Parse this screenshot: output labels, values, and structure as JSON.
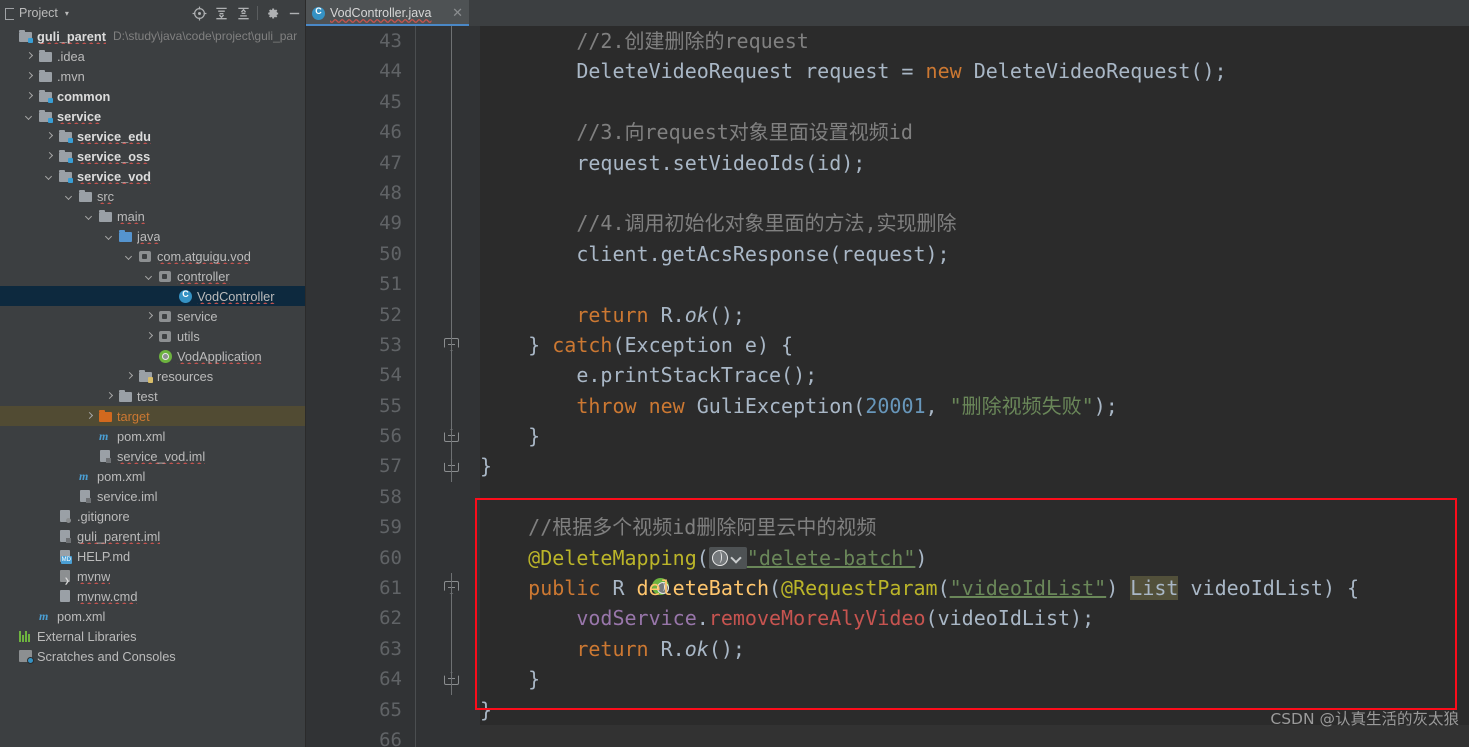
{
  "toolwindow": {
    "title": "Project",
    "dropdown_caret": "▾",
    "buttons": [
      {
        "name": "locate-in-tree",
        "label": "Select Opened File"
      },
      {
        "name": "expand-all",
        "label": "Expand All"
      },
      {
        "name": "collapse-all",
        "label": "Collapse All"
      },
      {
        "name": "settings",
        "label": "Settings"
      },
      {
        "name": "hide",
        "label": "Hide"
      }
    ]
  },
  "tree": [
    {
      "label": "guli_parent",
      "detail": "D:\\study\\java\\code\\project\\guli_par",
      "indent": 0,
      "icon": "module-folder-icon",
      "toggle": "none",
      "bold": true,
      "spell": true
    },
    {
      "label": ".idea",
      "indent": 1,
      "icon": "folder-icon",
      "toggle": "right"
    },
    {
      "label": ".mvn",
      "indent": 1,
      "icon": "folder-icon",
      "toggle": "right"
    },
    {
      "label": "common",
      "indent": 1,
      "icon": "module-folder-icon",
      "toggle": "right",
      "bold": true
    },
    {
      "label": "service",
      "indent": 1,
      "icon": "module-folder-icon",
      "toggle": "down",
      "bold": true,
      "spell": true
    },
    {
      "label": "service_edu",
      "indent": 2,
      "icon": "module-folder-icon",
      "toggle": "right",
      "bold": true,
      "spell": true
    },
    {
      "label": "service_oss",
      "indent": 2,
      "icon": "module-folder-icon",
      "toggle": "right",
      "bold": true,
      "spell": true
    },
    {
      "label": "service_vod",
      "indent": 2,
      "icon": "module-folder-icon",
      "toggle": "down",
      "bold": true,
      "spell": true
    },
    {
      "label": "src",
      "indent": 3,
      "icon": "folder-icon",
      "toggle": "down",
      "spell": true
    },
    {
      "label": "main",
      "indent": 4,
      "icon": "folder-icon",
      "toggle": "down",
      "spell": true
    },
    {
      "label": "java",
      "indent": 5,
      "icon": "source-folder-icon",
      "toggle": "down",
      "spell": true
    },
    {
      "label": "com.atguigu.vod",
      "indent": 6,
      "icon": "package-icon",
      "toggle": "down",
      "spell": true
    },
    {
      "label": "controller",
      "indent": 7,
      "icon": "package-icon",
      "toggle": "down",
      "spell": true
    },
    {
      "label": "VodController",
      "indent": 8,
      "icon": "class-icon",
      "toggle": "none",
      "selected": true,
      "spell": true
    },
    {
      "label": "service",
      "indent": 7,
      "icon": "package-icon",
      "toggle": "right"
    },
    {
      "label": "utils",
      "indent": 7,
      "icon": "package-icon",
      "toggle": "right"
    },
    {
      "label": "VodApplication",
      "indent": 7,
      "icon": "spring-boot-icon",
      "toggle": "none",
      "spell": true
    },
    {
      "label": "resources",
      "indent": 6,
      "icon": "resources-folder-icon",
      "toggle": "right"
    },
    {
      "label": "test",
      "indent": 5,
      "icon": "folder-icon",
      "toggle": "right"
    },
    {
      "label": "target",
      "indent": 4,
      "icon": "excluded-folder-icon",
      "toggle": "right",
      "excluded": true,
      "orange": true
    },
    {
      "label": "pom.xml",
      "indent": 4,
      "icon": "maven-icon",
      "toggle": "none"
    },
    {
      "label": "service_vod.iml",
      "indent": 4,
      "icon": "iml-file-icon",
      "toggle": "none",
      "spell": true
    },
    {
      "label": "pom.xml",
      "indent": 3,
      "icon": "maven-icon",
      "toggle": "none"
    },
    {
      "label": "service.iml",
      "indent": 3,
      "icon": "iml-file-icon",
      "toggle": "none"
    },
    {
      "label": ".gitignore",
      "indent": 2,
      "icon": "gitignore-file-icon",
      "toggle": "none"
    },
    {
      "label": "guli_parent.iml",
      "indent": 2,
      "icon": "iml-file-icon",
      "toggle": "none",
      "spell": true
    },
    {
      "label": "HELP.md",
      "indent": 2,
      "icon": "markdown-file-icon",
      "toggle": "none"
    },
    {
      "label": "mvnw",
      "indent": 2,
      "icon": "shell-script-icon",
      "toggle": "none",
      "spell": true
    },
    {
      "label": "mvnw.cmd",
      "indent": 2,
      "icon": "cmd-file-icon",
      "toggle": "none",
      "spell": true
    },
    {
      "label": "pom.xml",
      "indent": 1,
      "icon": "maven-icon",
      "toggle": "none"
    },
    {
      "label": "External Libraries",
      "indent": 0,
      "icon": "libraries-icon",
      "toggle": "none"
    },
    {
      "label": "Scratches and Consoles",
      "indent": 0,
      "icon": "scratches-icon",
      "toggle": "none"
    }
  ],
  "editor": {
    "tab": {
      "title": "VodController.java",
      "icon": "java-class-icon",
      "close": "✕"
    },
    "first_line_number": 43,
    "lines": [
      {
        "n": 43,
        "tokens": [
          {
            "t": "        //2.创建删除的request",
            "c": "c-com"
          }
        ]
      },
      {
        "n": 44,
        "tokens": [
          {
            "t": "        DeleteVideoRequest request = ",
            "c": "c-txt"
          },
          {
            "t": "new ",
            "c": "c-kw"
          },
          {
            "t": "DeleteVideoRequest();",
            "c": "c-txt"
          }
        ]
      },
      {
        "n": 45,
        "tokens": []
      },
      {
        "n": 46,
        "tokens": [
          {
            "t": "        //3.向request对象里面设置视频id",
            "c": "c-com"
          }
        ]
      },
      {
        "n": 47,
        "tokens": [
          {
            "t": "        request.setVideoIds(id);",
            "c": "c-txt"
          }
        ]
      },
      {
        "n": 48,
        "tokens": []
      },
      {
        "n": 49,
        "tokens": [
          {
            "t": "        //4.调用初始化对象里面的方法,实现删除",
            "c": "c-com"
          }
        ]
      },
      {
        "n": 50,
        "tokens": [
          {
            "t": "        client.getAcsResponse(request);",
            "c": "c-txt"
          }
        ]
      },
      {
        "n": 51,
        "tokens": []
      },
      {
        "n": 52,
        "tokens": [
          {
            "t": "        ",
            "c": "c-txt"
          },
          {
            "t": "return ",
            "c": "c-kw"
          },
          {
            "t": "R.",
            "c": "c-txt"
          },
          {
            "t": "ok",
            "c": "c-txt c-static"
          },
          {
            "t": "();",
            "c": "c-txt"
          }
        ]
      },
      {
        "n": 53,
        "tokens": [
          {
            "t": "    } ",
            "c": "c-txt"
          },
          {
            "t": "catch",
            "c": "c-kw"
          },
          {
            "t": "(Exception e) {",
            "c": "c-txt"
          }
        ],
        "fold": "start"
      },
      {
        "n": 54,
        "tokens": [
          {
            "t": "        e.printStackTrace();",
            "c": "c-txt"
          }
        ]
      },
      {
        "n": 55,
        "tokens": [
          {
            "t": "        ",
            "c": "c-txt"
          },
          {
            "t": "throw new ",
            "c": "c-kw"
          },
          {
            "t": "GuliException(",
            "c": "c-txt"
          },
          {
            "t": "20001",
            "c": "c-num"
          },
          {
            "t": ", ",
            "c": "c-txt"
          },
          {
            "t": "\"删除视频失败\"",
            "c": "c-str"
          },
          {
            "t": ");",
            "c": "c-txt"
          }
        ]
      },
      {
        "n": 56,
        "tokens": [
          {
            "t": "    }",
            "c": "c-txt"
          }
        ],
        "fold": "end"
      },
      {
        "n": 57,
        "tokens": [
          {
            "t": "}",
            "c": "c-txt"
          }
        ],
        "fold": "end"
      },
      {
        "n": 58,
        "tokens": []
      },
      {
        "n": 59,
        "tokens": [
          {
            "t": "    //根据多个视频id删除阿里云中的视频",
            "c": "c-com"
          }
        ]
      },
      {
        "n": 60,
        "tokens": [
          {
            "t": "    @DeleteMapping",
            "c": "c-ann"
          },
          {
            "t": "(",
            "c": "c-txt"
          },
          {
            "widget": "request-mapping-globe"
          },
          {
            "t": "\"delete-batch\"",
            "c": "c-ulink"
          },
          {
            "t": ")",
            "c": "c-txt"
          }
        ]
      },
      {
        "n": 61,
        "tokens": [
          {
            "t": "    public ",
            "c": "c-kw"
          },
          {
            "t": "R ",
            "c": "c-txt"
          },
          {
            "t": "deleteBatch",
            "c": "c-meth"
          },
          {
            "t": "(",
            "c": "c-txt"
          },
          {
            "t": "@RequestParam",
            "c": "c-ann"
          },
          {
            "t": "(",
            "c": "c-txt"
          },
          {
            "t": "\"videoIdList\"",
            "c": "c-ulink"
          },
          {
            "t": ") ",
            "c": "c-txt"
          },
          {
            "t": "List",
            "c": "c-txt c-warn"
          },
          {
            "t": " videoIdList) {",
            "c": "c-txt"
          }
        ],
        "gutter_icon": "spring-request-mapping-icon",
        "fold": "start"
      },
      {
        "n": 62,
        "tokens": [
          {
            "t": "        ",
            "c": "c-txt"
          },
          {
            "t": "vodService",
            "c": "c-field"
          },
          {
            "t": ".",
            "c": "c-txt"
          },
          {
            "t": "removeMoreAlyVideo",
            "c": "c-deprecated"
          },
          {
            "t": "(videoIdList);",
            "c": "c-txt"
          }
        ]
      },
      {
        "n": 63,
        "tokens": [
          {
            "t": "        ",
            "c": "c-txt"
          },
          {
            "t": "return ",
            "c": "c-kw"
          },
          {
            "t": "R.",
            "c": "c-txt"
          },
          {
            "t": "ok",
            "c": "c-txt c-static"
          },
          {
            "t": "();",
            "c": "c-txt"
          }
        ]
      },
      {
        "n": 64,
        "tokens": [
          {
            "t": "    }",
            "c": "c-txt"
          }
        ],
        "fold": "end"
      },
      {
        "n": 65,
        "tokens": [
          {
            "t": "}",
            "c": "c-txt"
          }
        ]
      },
      {
        "n": 66,
        "tokens": [],
        "caret": true
      }
    ]
  },
  "annotation": {
    "highlight_box_color": "#fc0d1b",
    "watermark": "CSDN @认真生活的灰太狼"
  }
}
